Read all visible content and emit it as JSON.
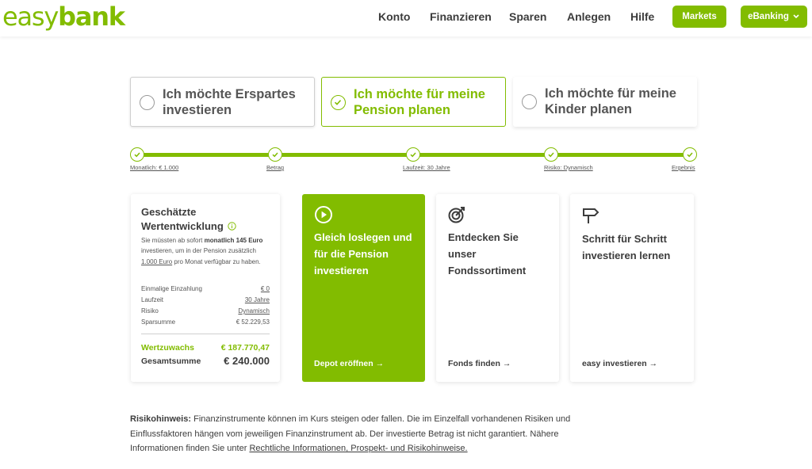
{
  "header": {
    "logo_light": "easy",
    "logo_bold": "bank",
    "nav": [
      "Konto",
      "Finanzieren",
      "Sparen",
      "Anlegen",
      "Hilfe"
    ],
    "markets_label": "Markets",
    "ebanking_label": "eBanking"
  },
  "goals": [
    {
      "label_line1": "Ich möchte Erspartes",
      "label_line2": "investieren",
      "selected": false
    },
    {
      "label_line1": "Ich möchte für meine",
      "label_line2": "Pension planen",
      "selected": true
    },
    {
      "label_line1": "Ich möchte für meine",
      "label_line2": "Kinder planen",
      "selected": false
    }
  ],
  "steps": [
    "Monatlich: € 1.000",
    "Betrag",
    "Laufzeit: 30 Jahre",
    "Risiko: Dynamisch",
    "Ergebnis"
  ],
  "summary": {
    "title_line1": "Geschätzte",
    "title_line2": "Wertentwicklung",
    "text_prefix": "Sie müssten ab sofort",
    "text_bold1": "monatlich 145",
    "text_bold2": "Euro",
    "text_mid": "investieren, um in der Pension zusätzlich",
    "text_amount": "1.000 Euro",
    "text_suffix": "pro Monat verfügbar zu haben.",
    "rows": [
      {
        "key": "Einmalige Einzahlung",
        "value": "€ 0"
      },
      {
        "key": "Laufzeit",
        "value": "30 Jahre"
      },
      {
        "key": "Risiko",
        "value": "Dynamisch"
      },
      {
        "key": "Sparsumme",
        "value": "€ 52.229,53"
      }
    ],
    "growth_label": "Wertzuwachs",
    "growth_value": "€ 187.770,47",
    "total_label": "Gesamtsumme",
    "total_value": "€ 240.000"
  },
  "tiles": [
    {
      "title": [
        "Gleich loslegen und",
        "für die Pension",
        "investieren"
      ],
      "link": "Depot eröffnen",
      "icon": "play-circle-icon"
    },
    {
      "title": [
        "Entdecken Sie",
        "unser",
        "Fondssortiment"
      ],
      "link": "Fonds finden",
      "icon": "target-icon"
    },
    {
      "title": [
        "Schritt für Schritt",
        "investieren lernen"
      ],
      "link": "easy investieren",
      "icon": "signpost-icon"
    }
  ],
  "risk": {
    "label": "Risikohinweis:",
    "text": "Finanzinstrumente können im Kurs steigen oder fallen. Die im Einzelfall vorhandenen Risiken und Einflussfaktoren hängen vom jeweiligen Finanzinstrument ab. Der investierte Betrag ist nicht garantiert. Nähere Informationen finden Sie unter",
    "link": "Rechtliche Informationen, Prospekt- und Risikohinweise."
  },
  "colors": {
    "accent": "#82bc00",
    "text": "#3c3c3c"
  }
}
